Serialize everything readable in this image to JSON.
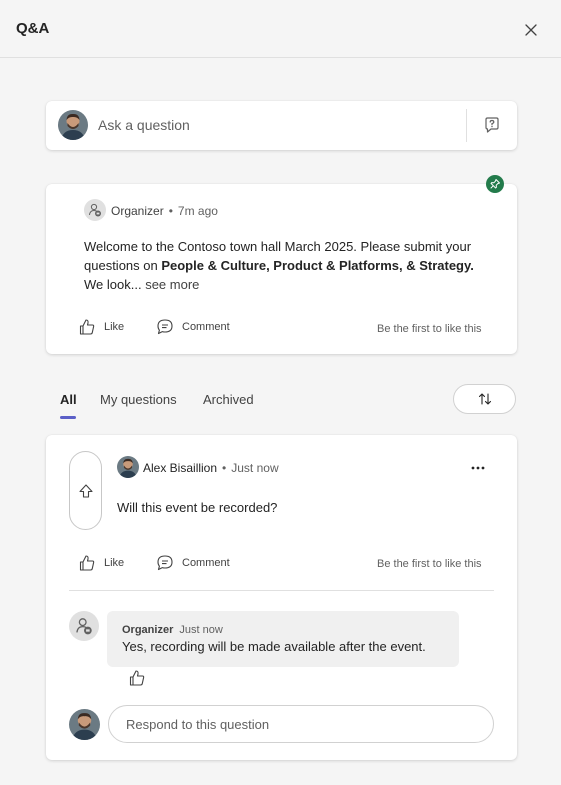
{
  "header": {
    "title": "Q&A"
  },
  "ask": {
    "placeholder": "Ask a question"
  },
  "announcement": {
    "author": "Organizer",
    "separator": "•",
    "time": "7m ago",
    "text_start": "Welcome to the Contoso town hall March 2025. Please submit your questions on ",
    "text_bold": "People & Culture, Product & Platforms, & Strategy.",
    "text_end": " We look... ",
    "see_more": "see more",
    "like_label": "Like",
    "comment_label": "Comment",
    "first_like": "Be the first to like this"
  },
  "tabs": [
    {
      "label": "All",
      "active": true
    },
    {
      "label": "My questions",
      "active": false
    },
    {
      "label": "Archived",
      "active": false
    }
  ],
  "question": {
    "author": "Alex Bisaillion",
    "separator": "•",
    "time": "Just now",
    "text": "Will this event be recorded?",
    "like_label": "Like",
    "comment_label": "Comment",
    "first_like": "Be the first to like this",
    "reply": {
      "author": "Organizer",
      "time": "Just now",
      "text": "Yes, recording will be made available after the event."
    },
    "respond_placeholder": "Respond to this question"
  },
  "colors": {
    "accent": "#5b5fc7",
    "pin": "#237b4b",
    "card": "#ffffff",
    "background": "#f5f5f5"
  },
  "icons": [
    "close-icon",
    "ask-question-icon",
    "pin-icon",
    "organizer-icon",
    "like-icon",
    "comment-icon",
    "sort-icon",
    "upvote-icon",
    "more-icon"
  ]
}
